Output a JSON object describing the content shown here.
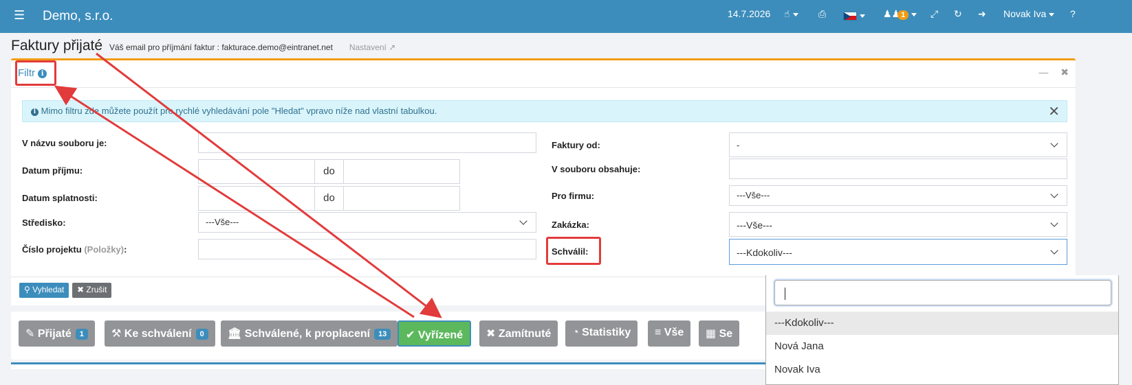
{
  "topbar": {
    "menu_icon": "hamburger-icon",
    "brand": "Demo, s.r.o.",
    "date": "14.7.2026",
    "notify_count": "1",
    "user": "Novak Iva",
    "help": "?",
    "bg_color": "#3c8dbc"
  },
  "page": {
    "title": "Faktury přijaté",
    "email_note": "Váš email pro příjmání faktur : fakturace.demo@eintranet.net",
    "settings_link": "Nastavení"
  },
  "filter": {
    "title": "Filtr",
    "alert": "Mimo filtru zde můžete použít pro rychlé vyhledávání pole \"Hledat\" vpravo níže nad vlastní tabulkou.",
    "labels": {
      "file_name": "V názvu souboru je:",
      "date_received": "Datum příjmu:",
      "date_due": "Datum splatnosti:",
      "center": "Středisko:",
      "project_no": "Číslo projektu",
      "project_no_hint": "(Položky)",
      "invoices_from": "Faktury od:",
      "file_contains": "V souboru obsahuje:",
      "for_company": "Pro firmu:",
      "order": "Zakázka:",
      "approved_by": "Schválil:"
    },
    "do_label": "do",
    "values": {
      "center": "---Vše---",
      "invoices_from": "-",
      "for_company": "---Vše---",
      "order": "---Vše---",
      "approved_by": "---Kdokoliv---"
    },
    "search_button": "Vyhledat",
    "cancel_button": "Zrušit"
  },
  "dropdown": {
    "options": [
      "---Kdokoliv---",
      "Nová Jana",
      "Novak Iva"
    ],
    "selected": "---Kdokoliv---"
  },
  "tabs": [
    {
      "label": "Přijaté",
      "count": "1",
      "icon": "edit-icon"
    },
    {
      "label": "Ke schválení",
      "count": "0",
      "icon": "gavel-icon"
    },
    {
      "label": "Schválené, k proplacení",
      "count": "13",
      "icon": "bank-icon"
    },
    {
      "label": "Vyřízené",
      "count": "",
      "icon": "check-icon"
    },
    {
      "label": "Zamítnuté",
      "count": "",
      "icon": "times-icon"
    },
    {
      "label": "Statistiky",
      "count": "",
      "icon": "pie-chart-icon"
    },
    {
      "label": "Vše",
      "count": "",
      "icon": "list-icon"
    },
    {
      "label": "Se",
      "count": "",
      "icon": "building-icon"
    }
  ],
  "colors": {
    "accent": "#3c8dbc",
    "box_border": "#f39c12",
    "active_tab": "#5cb85c",
    "tab_default": "#929497",
    "annotation": "#e23b3b"
  }
}
